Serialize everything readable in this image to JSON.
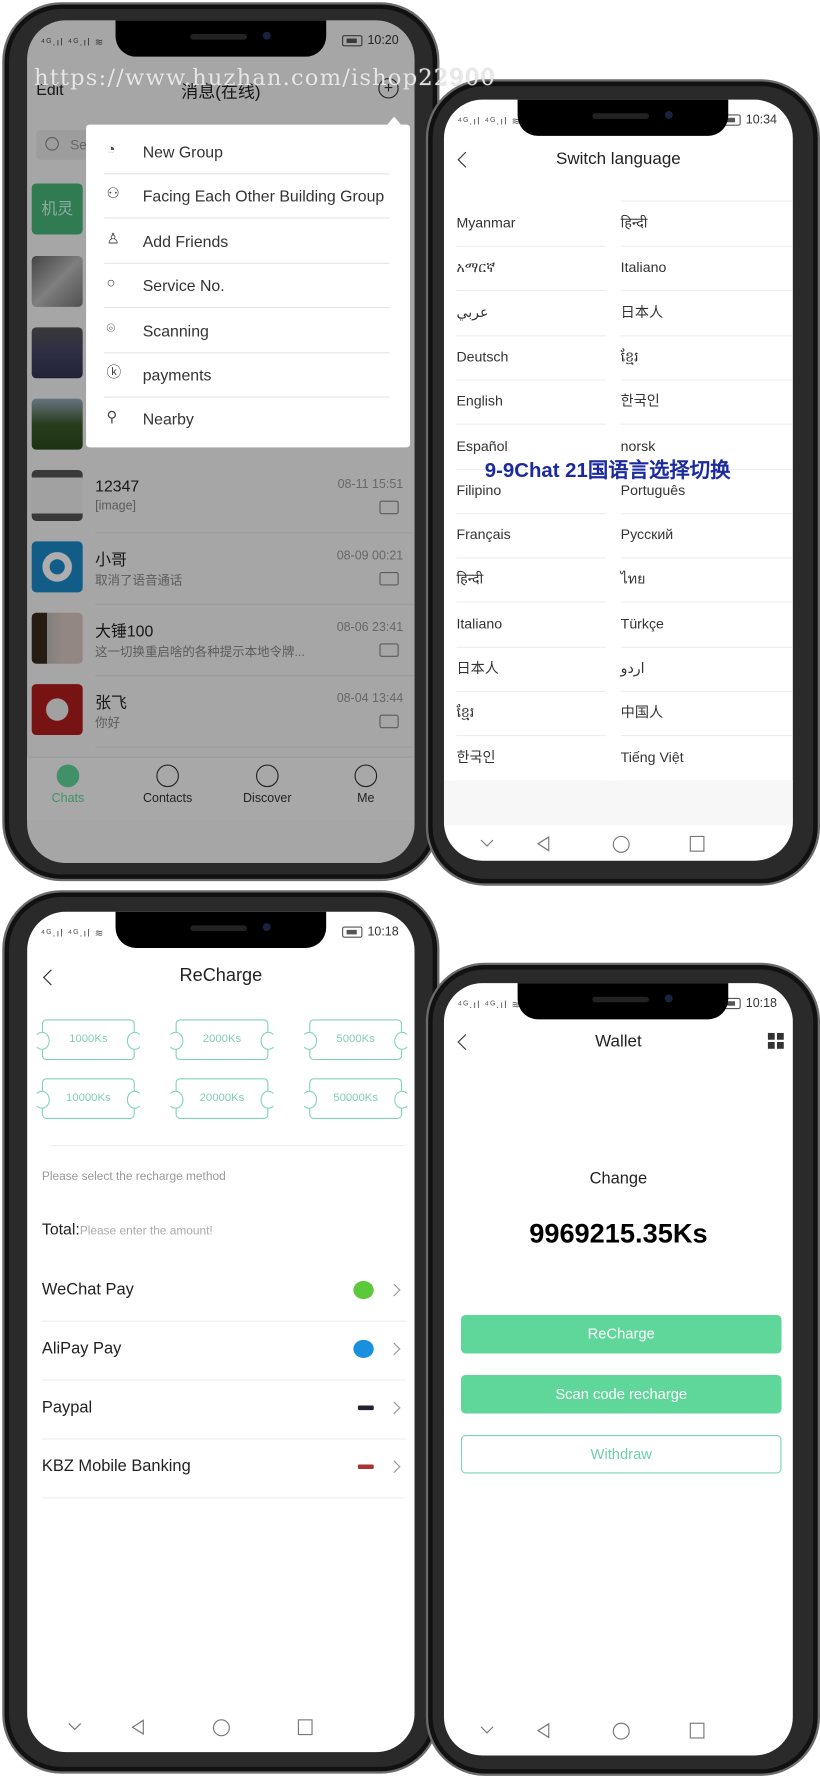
{
  "colors": {
    "accent": "#5fd69a",
    "outline": "#7fd5b5",
    "caption": "#1b2a9c",
    "overlay": "rgba(0,0,0,0.32)"
  },
  "watermark": "https://www.huzhan.com/ishop22900",
  "caption": "9-9Chat 21国语言选择切换",
  "chats_screen": {
    "status_time": "10:20",
    "edit_label": "Edit",
    "title": "消息(在线)",
    "search_placeholder": "Search",
    "menu_items": [
      {
        "label": "New Group",
        "icon": "group-chat-icon"
      },
      {
        "label": "Facing Each Other Building Group",
        "icon": "people-icon"
      },
      {
        "label": "Add Friends",
        "icon": "add-friend-icon"
      },
      {
        "label": "Service No.",
        "icon": "search-icon"
      },
      {
        "label": "Scanning",
        "icon": "scan-icon"
      },
      {
        "label": "payments",
        "icon": "ks-coin-icon"
      },
      {
        "label": "Nearby",
        "icon": "location-icon"
      }
    ],
    "top_avatar_text": "机灵",
    "chats": [
      {
        "name": "12347",
        "preview": "[image]",
        "time": "08-11 15:51"
      },
      {
        "name": "小哥",
        "preview": "取消了语音通话",
        "time": "08-09 00:21"
      },
      {
        "name": "大锤100",
        "preview": "这一切换重启啥的各种提示本地令牌...",
        "time": "08-06 23:41"
      },
      {
        "name": "张飞",
        "preview": "你好",
        "time": "08-04 13:44"
      }
    ],
    "tabs": [
      {
        "label": "Chats",
        "active": true
      },
      {
        "label": "Contacts",
        "active": false
      },
      {
        "label": "Discover",
        "active": false
      },
      {
        "label": "Me",
        "active": false
      }
    ]
  },
  "language_screen": {
    "status_time": "10:34",
    "title": "Switch language",
    "languages_left": [
      "Myanmar",
      "አማርኛ",
      "عربي",
      "Deutsch",
      "English",
      "Español",
      "Filipino",
      "Français",
      "हिन्दी",
      "Italiano",
      "日本人",
      "ខ្មែរ",
      "한국인"
    ],
    "languages_right": [
      "हिन्दी",
      "Italiano",
      "日本人",
      "ខ្មែរ",
      "한국인",
      "norsk",
      "Português",
      "Русский",
      "ไทย",
      "Türkçe",
      "اردو",
      "中国人",
      "Tiếng Việt"
    ]
  },
  "recharge_screen": {
    "status_time": "10:18",
    "title": "ReCharge",
    "amounts": [
      "1000Ks",
      "2000Ks",
      "5000Ks",
      "10000Ks",
      "20000Ks",
      "50000Ks"
    ],
    "method_hint": "Please select the recharge method",
    "total_label": "Total:",
    "total_placeholder": "Please enter the amount!",
    "methods": [
      {
        "label": "WeChat Pay",
        "icon": "wechat-icon",
        "color": "#5cc83a"
      },
      {
        "label": "AliPay Pay",
        "icon": "alipay-icon",
        "color": "#1a8fdd"
      },
      {
        "label": "Paypal",
        "icon": "paypal-icon",
        "color": "#223"
      },
      {
        "label": "KBZ Mobile Banking",
        "icon": "kbz-icon",
        "color": "#a33"
      }
    ]
  },
  "wallet_screen": {
    "status_time": "10:18",
    "title": "Wallet",
    "balance_label": "Change",
    "balance": "9969215.35Ks",
    "recharge_label": "ReCharge",
    "scan_label": "Scan code recharge",
    "withdraw_label": "Withdraw"
  }
}
